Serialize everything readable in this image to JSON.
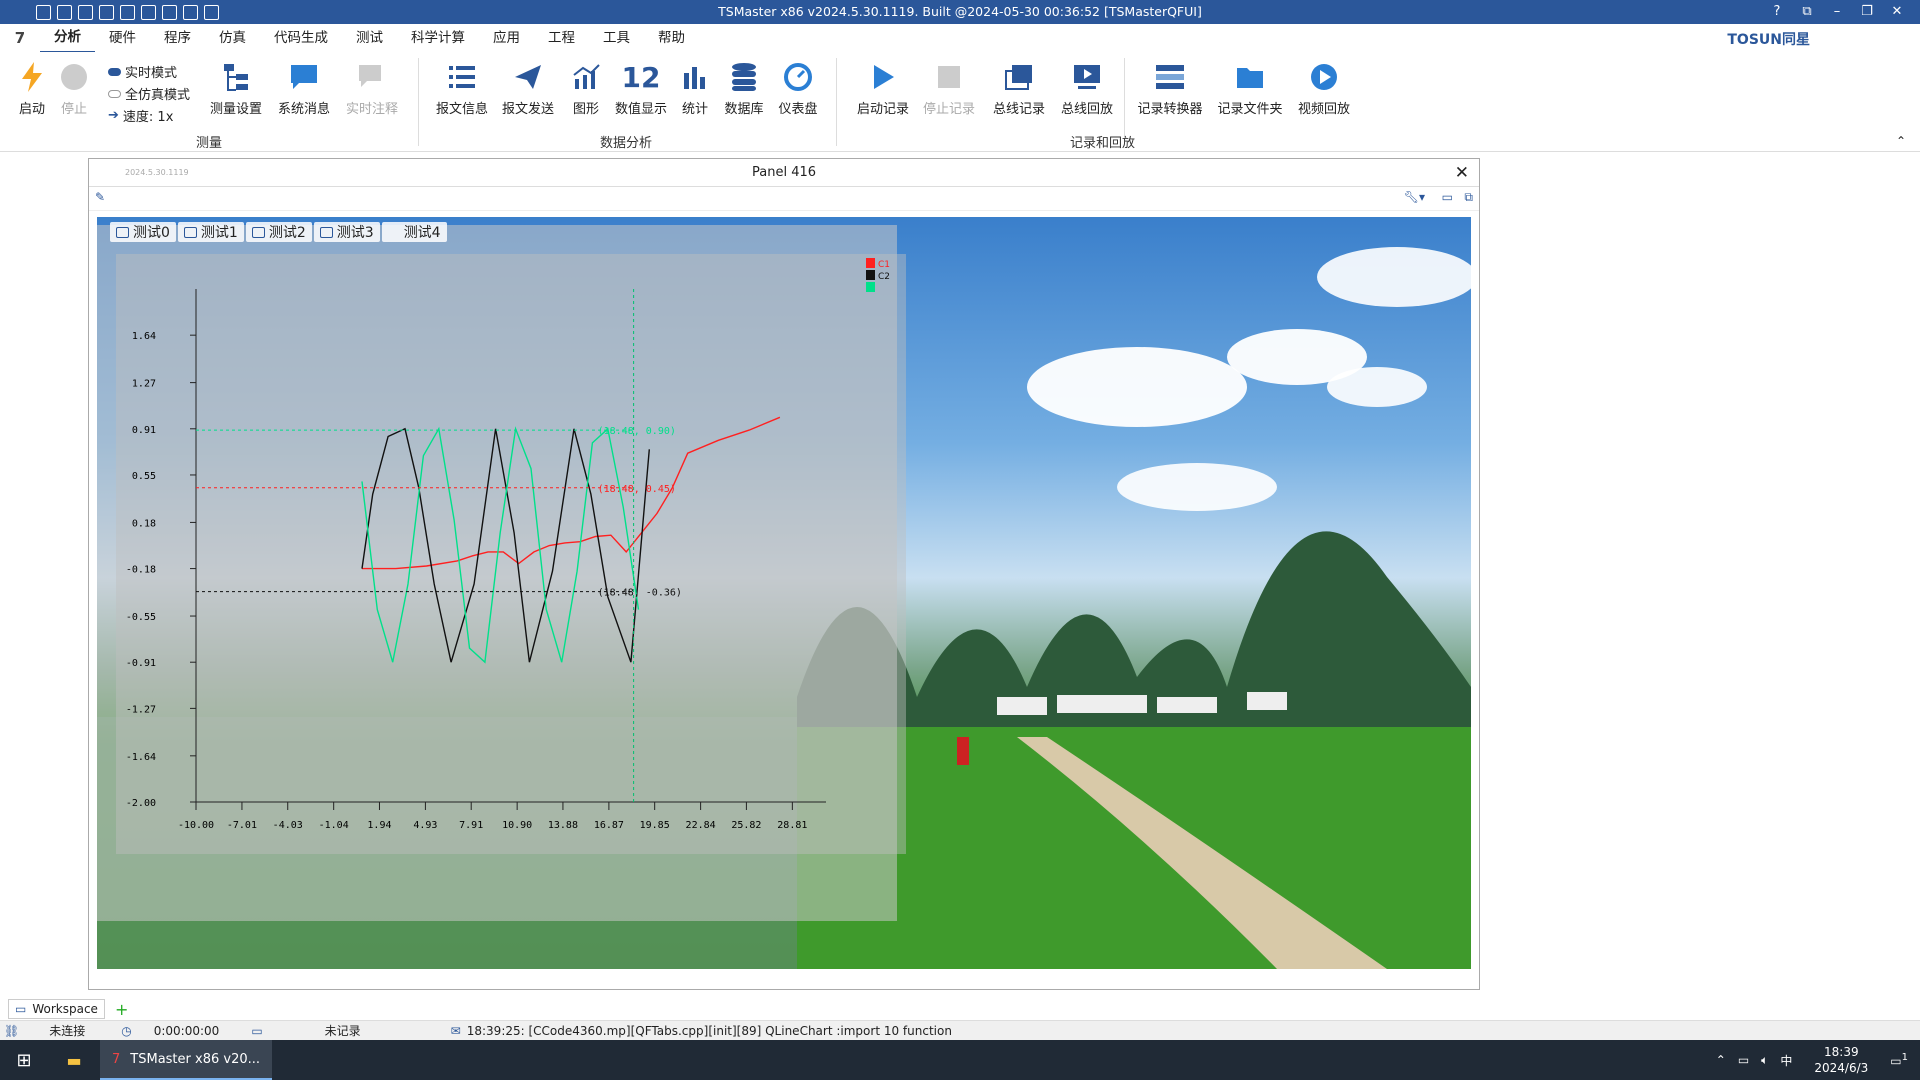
{
  "window": {
    "title": "TSMaster x86 v2024.5.30.1119. Built @2024-05-30 00:36:52 [TSMasterQFUI]",
    "controls": [
      "?",
      "⧉",
      "–",
      "❐",
      "✕"
    ]
  },
  "menu": {
    "items": [
      "分析",
      "硬件",
      "程序",
      "仿真",
      "代码生成",
      "测试",
      "科学计算",
      "应用",
      "工程",
      "工具",
      "帮助"
    ],
    "active": "分析",
    "brand": "TOSUN同星"
  },
  "ribbon": {
    "start": "启动",
    "stop": "停止",
    "modes": [
      "实时模式",
      "全仿真模式",
      "速度: 1x"
    ],
    "measure_setup": "测量设置",
    "sys_msg": "系统消息",
    "realtime_note": "实时注释",
    "group_measure": "测量",
    "msg_info": "报文信息",
    "msg_send": "报文发送",
    "graphic": "图形",
    "num_display": "数值显示",
    "value12": "12",
    "stats": "统计",
    "database": "数据库",
    "dashboard": "仪表盘",
    "group_analysis": "数据分析",
    "rec_start": "启动记录",
    "rec_stop": "停止记录",
    "bus_rec": "总线记录",
    "bus_replay": "总线回放",
    "rec_conv": "记录转换器",
    "rec_folder": "记录文件夹",
    "video_replay": "视频回放",
    "group_record": "记录和回放"
  },
  "panel": {
    "title": "Panel 416",
    "version": "2024.5.30.1119"
  },
  "tabs": [
    "测试0",
    "测试1",
    "测试2",
    "测试3",
    "测试4"
  ],
  "chart_data": {
    "type": "line",
    "xlim": [
      -10.0,
      31.0
    ],
    "ylim": [
      -2.0,
      2.0
    ],
    "xticks": [
      "-10.00",
      "-7.01",
      "-4.03",
      "-1.04",
      "1.94",
      "4.93",
      "7.91",
      "10.90",
      "13.88",
      "16.87",
      "19.85",
      "22.84",
      "25.82",
      "28.81"
    ],
    "yticks": [
      "1.64",
      "1.27",
      "0.91",
      "0.55",
      "0.18",
      "-0.18",
      "-0.55",
      "-0.91",
      "-1.27",
      "-1.64",
      "-2.00"
    ],
    "legend": [
      "C1",
      "C2",
      ""
    ],
    "colors": [
      "#ff2020",
      "#111111",
      "#00e08a"
    ],
    "cursor_labels": [
      "(18.48, 0.45)",
      "(18.48, -0.36)",
      "(18.48, 0.90)"
    ],
    "cursor_x": 18.48,
    "series": [
      {
        "name": "C1",
        "color": "#ff2020",
        "x": [
          0.8,
          3,
          5,
          7,
          8,
          9,
          10,
          11,
          12,
          13,
          14,
          15,
          16,
          17,
          18,
          19,
          20,
          21,
          22,
          24,
          26,
          28
        ],
        "y": [
          -0.18,
          -0.18,
          -0.16,
          -0.12,
          -0.08,
          -0.05,
          -0.05,
          -0.14,
          -0.05,
          0.0,
          0.02,
          0.03,
          0.07,
          0.08,
          -0.05,
          0.1,
          0.25,
          0.45,
          0.72,
          0.82,
          0.9,
          1.0
        ]
      },
      {
        "name": "C2",
        "color": "#111111",
        "x": [
          0.8,
          1.5,
          2.5,
          3.6,
          4.5,
          5.5,
          6.6,
          8.1,
          9.5,
          10.7,
          11.7,
          13.2,
          14.6,
          15.7,
          16.8,
          18.3,
          19.5
        ],
        "y": [
          -0.18,
          0.4,
          0.85,
          0.91,
          0.45,
          -0.3,
          -0.91,
          -0.3,
          0.91,
          0.1,
          -0.91,
          -0.2,
          0.91,
          0.4,
          -0.4,
          -0.91,
          0.75
        ]
      },
      {
        "name": "",
        "color": "#00e08a",
        "x": [
          0.8,
          1.8,
          2.8,
          3.8,
          4.8,
          5.8,
          6.8,
          7.8,
          8.8,
          9.8,
          10.8,
          11.8,
          12.8,
          13.8,
          14.8,
          15.8,
          16.8,
          17.8,
          18.8
        ],
        "y": [
          0.5,
          -0.5,
          -0.91,
          -0.3,
          0.7,
          0.91,
          0.2,
          -0.8,
          -0.91,
          0.1,
          0.91,
          0.6,
          -0.5,
          -0.91,
          -0.2,
          0.8,
          0.91,
          0.3,
          -0.5
        ]
      }
    ]
  },
  "workspace": {
    "tab": "Workspace",
    "add": "+"
  },
  "status": {
    "connection": "未连接",
    "time": "0:00:00:00",
    "record": "未记录",
    "log": "18:39:25: [CCode4360.mp][QFTabs.cpp][init][89] QLineChart :import 10 function"
  },
  "taskbar": {
    "app": "TSMaster x86 v20...",
    "clock": "18:39",
    "date": "2024/6/3",
    "ime": "中",
    "notif": "1"
  }
}
